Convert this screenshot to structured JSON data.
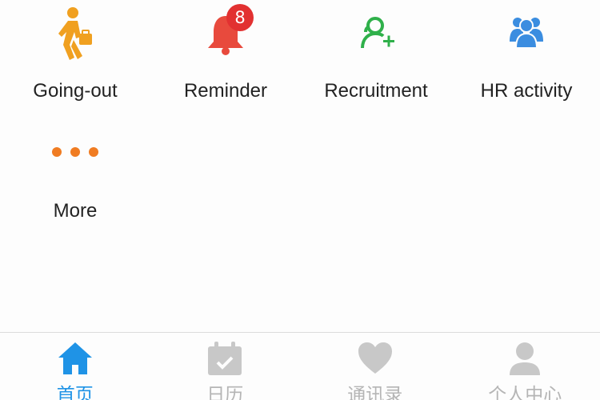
{
  "apps": [
    {
      "label": "Going-out",
      "icon": "walking-person-briefcase-icon"
    },
    {
      "label": "Reminder",
      "icon": "bell-icon",
      "badge": "8"
    },
    {
      "label": "Recruitment",
      "icon": "add-user-icon"
    },
    {
      "label": "HR activity",
      "icon": "group-icon"
    },
    {
      "label": "More",
      "icon": "more-dots-icon"
    }
  ],
  "tabbar": {
    "tabs": [
      {
        "label": "首页",
        "icon": "home-icon",
        "active": true
      },
      {
        "label": "日历",
        "icon": "calendar-check-icon",
        "active": false
      },
      {
        "label": "通讯录",
        "icon": "heart-icon",
        "active": false
      },
      {
        "label": "个人中心",
        "icon": "person-icon",
        "active": false
      }
    ]
  },
  "colors": {
    "orange": "#f0a020",
    "red": "#e23131",
    "green": "#2fb04a",
    "blue": "#3b8de0",
    "more_orange": "#f07c22",
    "active_tab": "#1f93e6",
    "inactive_tab": "#c8c8c8"
  }
}
